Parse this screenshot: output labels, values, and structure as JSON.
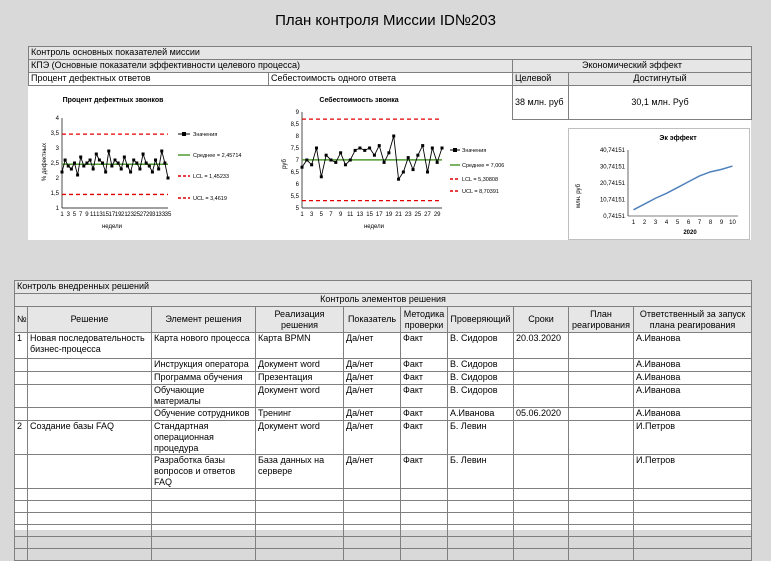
{
  "page_title": "План контроля Миссии ID№203",
  "section1": {
    "title": "Контроль основных показателей миссии",
    "kpi_label": "КПЭ (Основные показатели эффективности целевого процесса)",
    "econ_label": "Экономический эффект",
    "kpi1_name": "Процент дефектных ответов",
    "kpi2_name": "Себестоимость одного ответа",
    "target_label": "Целевой",
    "achieved_label": "Достигнутый",
    "target_value": "38 млн. руб",
    "achieved_value": "30,1 млн. Руб"
  },
  "chart_data": [
    {
      "type": "line",
      "title": "Процент дефектных звонков",
      "xlabel": "недели",
      "ylabel": "% дефектных",
      "ylim": [
        1,
        4
      ],
      "yticks": [
        "4",
        "3,5",
        "3",
        "2,5",
        "2",
        "1,5",
        "1"
      ],
      "xticks": [
        "1",
        "3",
        "5",
        "7",
        "9",
        "11",
        "13",
        "15",
        "17",
        "19",
        "21",
        "23",
        "25",
        "27",
        "29",
        "31",
        "33",
        "35"
      ],
      "x": [
        1,
        2,
        3,
        4,
        5,
        6,
        7,
        8,
        9,
        10,
        11,
        12,
        13,
        14,
        15,
        16,
        17,
        18,
        19,
        20,
        21,
        22,
        23,
        24,
        25,
        26,
        27,
        28,
        29,
        30,
        31,
        32,
        33,
        34,
        35
      ],
      "series": [
        {
          "name": "Значения",
          "values": [
            2.2,
            2.6,
            2.4,
            2.3,
            2.5,
            2.1,
            2.7,
            2.4,
            2.5,
            2.6,
            2.3,
            2.8,
            2.6,
            2.5,
            2.2,
            2.9,
            2.4,
            2.6,
            2.5,
            2.3,
            2.7,
            2.4,
            2.2,
            2.6,
            2.5,
            2.3,
            2.8,
            2.5,
            2.4,
            2.2,
            2.6,
            2.3,
            2.9,
            2.5,
            2.0
          ]
        },
        {
          "name": "Среднее = 2,45714",
          "values": [
            2.45714
          ]
        },
        {
          "name": "LCL = 1,45233",
          "values": [
            1.45233
          ]
        },
        {
          "name": "UCL = 3,4619",
          "values": [
            3.4619
          ]
        }
      ],
      "colors": {
        "values": "#000000",
        "mean": "#4e9a2e",
        "limits": "#e00000"
      }
    },
    {
      "type": "line",
      "title": "Себестоимость звонка",
      "xlabel": "недели",
      "ylabel": "руб",
      "ylim": [
        5,
        9
      ],
      "yticks": [
        "9",
        "8,5",
        "8",
        "7,5",
        "7",
        "6,5",
        "6",
        "5,5",
        "5"
      ],
      "xticks": [
        "1",
        "3",
        "5",
        "7",
        "9",
        "11",
        "13",
        "15",
        "17",
        "19",
        "21",
        "23",
        "25",
        "27",
        "29"
      ],
      "x": [
        1,
        2,
        3,
        4,
        5,
        6,
        7,
        8,
        9,
        10,
        11,
        12,
        13,
        14,
        15,
        16,
        17,
        18,
        19,
        20,
        21,
        22,
        23,
        24,
        25,
        26,
        27,
        28,
        29,
        30
      ],
      "series": [
        {
          "name": "Значения",
          "values": [
            6.7,
            7.0,
            6.8,
            7.5,
            6.3,
            7.2,
            7.0,
            6.9,
            7.3,
            6.8,
            7.0,
            7.4,
            7.5,
            7.4,
            7.5,
            7.2,
            7.6,
            6.9,
            7.3,
            8.0,
            6.2,
            6.5,
            7.1,
            6.6,
            7.2,
            7.6,
            6.5,
            7.5,
            6.9,
            7.5
          ]
        },
        {
          "name": "Среднее = 7,006",
          "values": [
            7.006
          ]
        },
        {
          "name": "LCL = 5,30808",
          "values": [
            5.30808
          ]
        },
        {
          "name": "UCL = 8,70391",
          "values": [
            8.70391
          ]
        }
      ],
      "colors": {
        "values": "#000000",
        "mean": "#4e9a2e",
        "limits": "#e00000"
      }
    },
    {
      "type": "line",
      "title": "Эк эффект",
      "xlabel": "2020",
      "ylabel": "млн. руб",
      "ylim": [
        0.74151,
        40.74151
      ],
      "yticks": [
        "40,74151",
        "30,74151",
        "20,74151",
        "10,74151",
        "0,74151"
      ],
      "categories": [
        "1",
        "2",
        "3",
        "4",
        "5",
        "6",
        "7",
        "8",
        "9",
        "10"
      ],
      "series": [
        {
          "name": "",
          "values": [
            4.5,
            8.0,
            11.5,
            14.5,
            18.0,
            21.5,
            25.0,
            27.5,
            29.0,
            31.0
          ]
        }
      ],
      "colors": {
        "line": "#4f81bd"
      }
    }
  ],
  "section2": {
    "title": "Контроль внедренных решений",
    "subheader": "Контроль элементов решения",
    "columns": [
      "№",
      "Решение",
      "Элемент решения",
      "Реализация решения",
      "Показатель",
      "Методика проверки",
      "Проверяющий",
      "Сроки",
      "План реагирования",
      "Ответственный за запуск плана реагирования"
    ],
    "rows": [
      [
        "1",
        "Новая последовательность бизнес-процесса",
        "Карта нового процесса",
        "Карта BPMN",
        "Да/нет",
        "Факт",
        "В. Сидоров",
        "20.03.2020",
        "",
        "А.Иванова"
      ],
      [
        "",
        "",
        "Инструкция оператора",
        "Документ word",
        "Да/нет",
        "Факт",
        "В. Сидоров",
        "",
        "",
        "А.Иванова"
      ],
      [
        "",
        "",
        "Программа обучения",
        "Презентация",
        "Да/нет",
        "Факт",
        "В. Сидоров",
        "",
        "",
        "А.Иванова"
      ],
      [
        "",
        "",
        "Обучающие материалы",
        "Документ word",
        "Да/нет",
        "Факт",
        "В. Сидоров",
        "",
        "",
        "А.Иванова"
      ],
      [
        "",
        "",
        "Обучение сотрудников",
        "Тренинг",
        "Да/нет",
        "Факт",
        "А.Иванова",
        "05.06.2020",
        "",
        "А.Иванова"
      ],
      [
        "2",
        "Создание базы FAQ",
        "Стандартная операционная процедура",
        "Документ word",
        "Да/нет",
        "Факт",
        "Б. Левин",
        "",
        "",
        "И.Петров"
      ],
      [
        "",
        "",
        "Разработка базы вопросов и ответов FAQ",
        "База данных на сервере",
        "Да/нет",
        "Факт",
        "Б. Левин",
        "",
        "",
        "И.Петров"
      ]
    ]
  }
}
